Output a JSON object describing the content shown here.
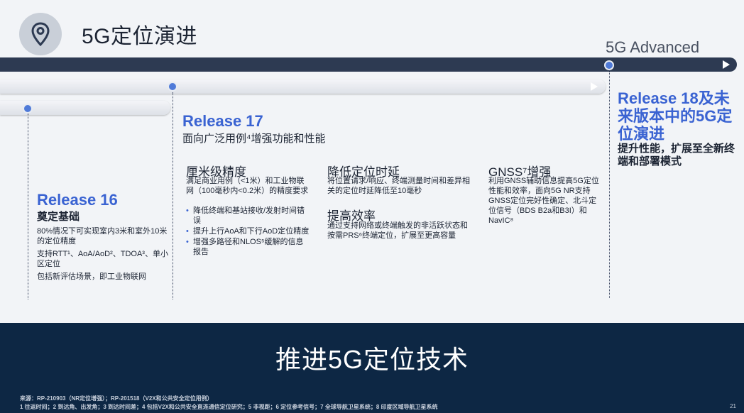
{
  "header": {
    "title": "5G定位演进",
    "advanced_label": "5G Advanced",
    "logo_icon": "location-pin-icon"
  },
  "release16": {
    "title": "Release 16",
    "subtitle": "奠定基础",
    "p1": "80%情况下可实现室内3米和室外10米的定位精度",
    "p2": "支持RTT¹、AoA/AoD²、TDOA³、单小区定位",
    "p3": "包括新评估场景，即工业物联网"
  },
  "release17": {
    "title": "Release 17",
    "subtitle": "面向广泛用例⁴增强功能和性能",
    "col1": {
      "title": "厘米级精度",
      "body": "满足商业用例（<1米）和工业物联网（100毫秒内<0.2米）的精度要求",
      "items": [
        "降低终端和基站接收/发射时间错误",
        "提升上行AoA和下行AoD定位精度",
        "增强多路径和NLOS⁵缓解的信息报告"
      ]
    },
    "col2": {
      "title": "降低定位时延",
      "body": "将位置请求/响应、终端测量时间和差异相关的定位时延降低至10毫秒"
    },
    "col3": {
      "title": "提高效率",
      "body": "通过支持网络或终端触发的非活跃状态和按需PRS⁶终端定位，扩展至更高容量"
    },
    "col4": {
      "title": "GNSS⁷增强",
      "body": "利用GNSS辅助信息提高5G定位性能和效率，面向5G NR支持GNSS定位完好性确定、北斗定位信号（BDS B2a和B3I）和NavIC⁸"
    }
  },
  "release18": {
    "title": "Release 18及未来版本中的5G定位演进",
    "subtitle": "提升性能，扩展至全新终端和部署模式"
  },
  "banner": {
    "text": "推进5G定位技术"
  },
  "footer": {
    "source": "来源：RP-210903（NR定位增强）；RP-201518（V2X和公共安全定位用例）",
    "notes": "1 往返时间；2 到达角、出发角；3 到达时间差；4 包括V2X和公共安全直连通信定位研究；5 非视距；6 定位参考信号；7 全球导航卫星系统；8 印度区域导航卫星系统",
    "page": "21"
  },
  "colors": {
    "accent": "#3a63d2",
    "dark_navy": "#0d2744",
    "bar_dark": "#2d3a52"
  }
}
